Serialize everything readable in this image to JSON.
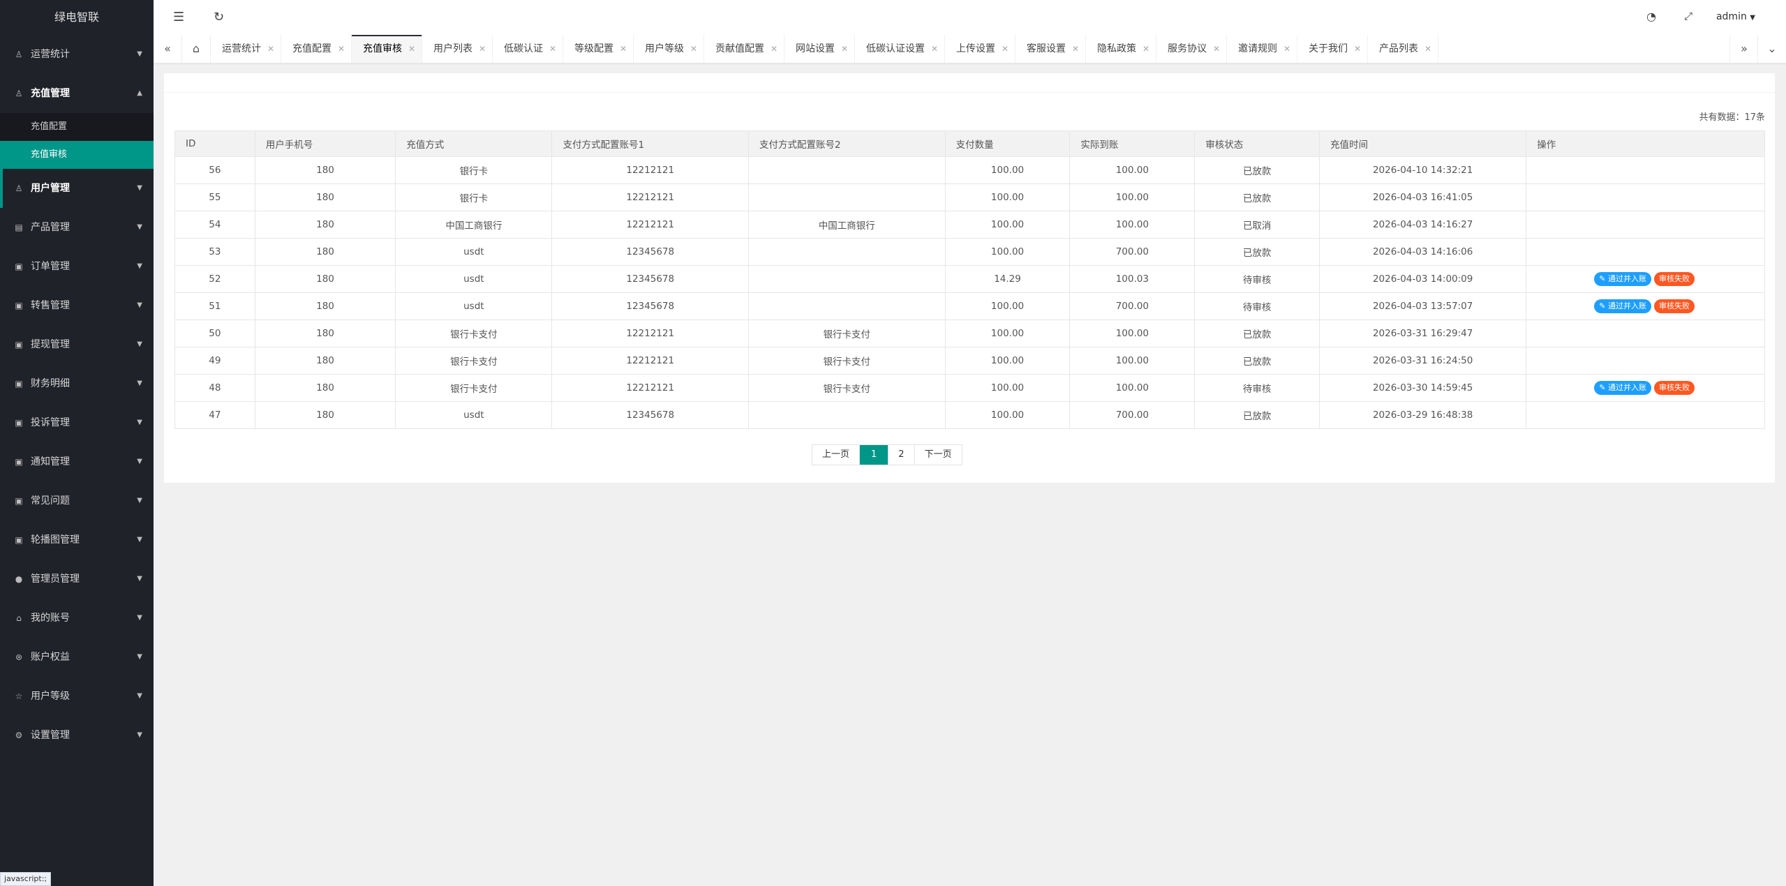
{
  "app": {
    "title": "绿电智联"
  },
  "sidebar": {
    "groups": [
      {
        "label": "运营统计",
        "icon": "user-icon",
        "expanded": false
      },
      {
        "label": "充值管理",
        "icon": "user-icon",
        "expanded": true,
        "sub": [
          {
            "label": "充值配置",
            "active": false
          },
          {
            "label": "充值审核",
            "active": true
          }
        ]
      },
      {
        "label": "用户管理",
        "icon": "user-icon",
        "expanded": false
      },
      {
        "label": "产品管理",
        "icon": "file-icon",
        "expanded": false
      },
      {
        "label": "订单管理",
        "icon": "image-icon",
        "expanded": false
      },
      {
        "label": "转售管理",
        "icon": "image-icon",
        "expanded": false
      },
      {
        "label": "提现管理",
        "icon": "image-icon",
        "expanded": false
      },
      {
        "label": "财务明细",
        "icon": "image-icon",
        "expanded": false
      },
      {
        "label": "投诉管理",
        "icon": "image-icon",
        "expanded": false
      },
      {
        "label": "通知管理",
        "icon": "image-icon",
        "expanded": false
      },
      {
        "label": "常见问题",
        "icon": "image-icon",
        "expanded": false
      },
      {
        "label": "轮播图管理",
        "icon": "image-icon",
        "expanded": false
      },
      {
        "label": "管理员管理",
        "icon": "person-icon",
        "expanded": false
      },
      {
        "label": "我的账号",
        "icon": "home-icon",
        "expanded": false
      },
      {
        "label": "账户权益",
        "icon": "settings-icon",
        "expanded": false
      },
      {
        "label": "用户等级",
        "icon": "star-icon",
        "expanded": false
      },
      {
        "label": "设置管理",
        "icon": "gear-icon",
        "expanded": false
      }
    ]
  },
  "topbar": {
    "user": "admin"
  },
  "tabs": [
    "运营统计",
    "充值配置",
    "充值审核",
    "用户列表",
    "低碳认证",
    "等级配置",
    "用户等级",
    "贡献值配置",
    "网站设置",
    "低碳认证设置",
    "上传设置",
    "客服设置",
    "隐私政策",
    "服务协议",
    "邀请规则",
    "关于我们",
    "产品列表"
  ],
  "active_tab": "充值审核",
  "summary": {
    "total_text": "共有数据：17条"
  },
  "table": {
    "headers": [
      "ID",
      "用户手机号",
      "充值方式",
      "支付方式配置账号1",
      "支付方式配置账号2",
      "支付数量",
      "实际到账",
      "审核状态",
      "充值时间",
      "操作"
    ],
    "rows": [
      {
        "id": "56",
        "phone": "180",
        "method": "银行卡",
        "acct1": "12212121",
        "acct2": "",
        "amount": "100.00",
        "received": "100.00",
        "status": "已放款",
        "time": "2026-04-10 14:32:21",
        "ops": false
      },
      {
        "id": "55",
        "phone": "180",
        "method": "银行卡",
        "acct1": "12212121",
        "acct2": "",
        "amount": "100.00",
        "received": "100.00",
        "status": "已放款",
        "time": "2026-04-03 16:41:05",
        "ops": false
      },
      {
        "id": "54",
        "phone": "180",
        "method": "中国工商银行",
        "acct1": "12212121",
        "acct2": "中国工商银行",
        "amount": "100.00",
        "received": "100.00",
        "status": "已取消",
        "time": "2026-04-03 14:16:27",
        "ops": false
      },
      {
        "id": "53",
        "phone": "180",
        "method": "usdt",
        "acct1": "12345678",
        "acct2": "",
        "amount": "100.00",
        "received": "700.00",
        "status": "已放款",
        "time": "2026-04-03 14:16:06",
        "ops": false
      },
      {
        "id": "52",
        "phone": "180",
        "method": "usdt",
        "acct1": "12345678",
        "acct2": "",
        "amount": "14.29",
        "received": "100.03",
        "status": "待审核",
        "time": "2026-04-03 14:00:09",
        "ops": true
      },
      {
        "id": "51",
        "phone": "180",
        "method": "usdt",
        "acct1": "12345678",
        "acct2": "",
        "amount": "100.00",
        "received": "700.00",
        "status": "待审核",
        "time": "2026-04-03 13:57:07",
        "ops": true
      },
      {
        "id": "50",
        "phone": "180",
        "method": "银行卡支付",
        "acct1": "12212121",
        "acct2": "银行卡支付",
        "amount": "100.00",
        "received": "100.00",
        "status": "已放款",
        "time": "2026-03-31 16:29:47",
        "ops": false
      },
      {
        "id": "49",
        "phone": "180",
        "method": "银行卡支付",
        "acct1": "12212121",
        "acct2": "银行卡支付",
        "amount": "100.00",
        "received": "100.00",
        "status": "已放款",
        "time": "2026-03-31 16:24:50",
        "ops": false
      },
      {
        "id": "48",
        "phone": "180",
        "method": "银行卡支付",
        "acct1": "12212121",
        "acct2": "银行卡支付",
        "amount": "100.00",
        "received": "100.00",
        "status": "待审核",
        "time": "2026-03-30 14:59:45",
        "ops": true
      },
      {
        "id": "47",
        "phone": "180",
        "method": "usdt",
        "acct1": "12345678",
        "acct2": "",
        "amount": "100.00",
        "received": "700.00",
        "status": "已放款",
        "time": "2026-03-29 16:48:38",
        "ops": false
      }
    ],
    "actions": {
      "pass_label": "通过并入账",
      "fail_label": "审核失败"
    }
  },
  "pagination": {
    "prev": "上一页",
    "pages": [
      "1",
      "2"
    ],
    "current": "1",
    "next": "下一页"
  },
  "statusbar": {
    "text": "javascript:;"
  },
  "colors": {
    "accent": "#009688",
    "sidebar_bg": "#20222a",
    "pass_btn": "#1e9fff",
    "fail_btn": "#ff5722"
  }
}
